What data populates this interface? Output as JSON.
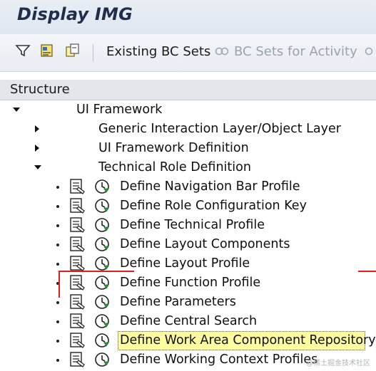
{
  "title": "Display IMG",
  "toolbar": {
    "icons": [
      "filter-icon",
      "transport-icon",
      "copy-icon"
    ],
    "existing_bc_sets": "Existing BC Sets",
    "bc_sets_for_activity": "BC Sets for Activity"
  },
  "structure": {
    "header": "Structure",
    "root": "UI Framework",
    "level1": [
      {
        "label": "Generic Interaction Layer/Object Layer",
        "state": "collapsed"
      },
      {
        "label": "UI Framework Definition",
        "state": "collapsed"
      },
      {
        "label": "Technical Role Definition",
        "state": "expanded"
      }
    ],
    "activities": [
      "Define Navigation Bar Profile",
      "Define Role Configuration Key",
      "Define Technical Profile",
      "Define Layout Components",
      "Define Layout Profile",
      "Define Function Profile",
      "Define Parameters",
      "Define Central Search",
      "Define Work Area Component Repository",
      "Define Working Context Profiles"
    ],
    "selected_activity_index": 8
  },
  "watermark": "@稀土掘金技术社区",
  "colors": {
    "highlight": "#fffda0",
    "annotation": "#e11d1d",
    "icon_green": "#2e9b3a"
  }
}
